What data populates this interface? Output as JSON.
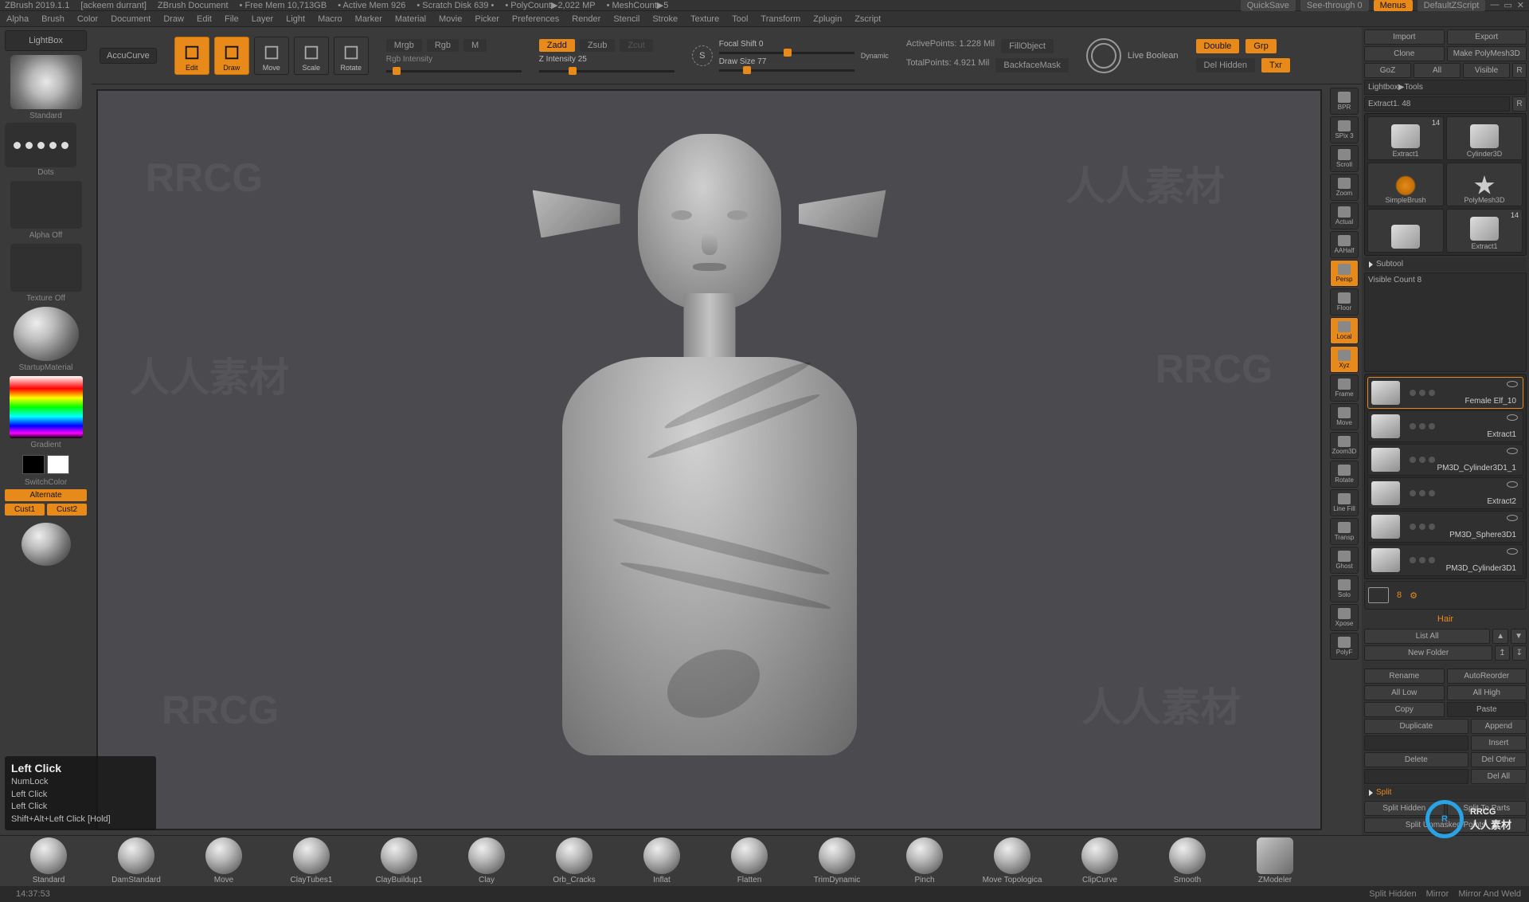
{
  "titlebar": {
    "app": "ZBrush 2019.1.1",
    "user": "[ackeem durrant]",
    "doc": "ZBrush Document",
    "free_mem": "Free Mem 10,713GB",
    "active_mem": "Active Mem 926",
    "scratch": "Scratch Disk 639",
    "polycount": "PolyCount▶2,022 MP",
    "meshcount": "MeshCount▶5",
    "quicksave": "QuickSave",
    "seethrough": "See-through  0",
    "menus": "Menus",
    "zscript": "DefaultZScript"
  },
  "menubar": [
    "Alpha",
    "Brush",
    "Color",
    "Document",
    "Draw",
    "Edit",
    "File",
    "Layer",
    "Light",
    "Macro",
    "Marker",
    "Material",
    "Movie",
    "Picker",
    "Preferences",
    "Render",
    "Stencil",
    "Stroke",
    "Texture",
    "Tool",
    "Transform",
    "Zplugin",
    "Zscript"
  ],
  "lightbox": "LightBox",
  "accucurve": "AccuCurve",
  "left": {
    "brush": "Standard",
    "stroke": "Dots",
    "alpha": "Alpha Off",
    "texture": "Texture Off",
    "material": "StartupMaterial",
    "gradient": "Gradient",
    "switch": "SwitchColor",
    "alternate": "Alternate",
    "cust1": "Cust1",
    "cust2": "Cust2"
  },
  "hint": {
    "title": "Left Click",
    "l1": "NumLock",
    "l2": "Left Click",
    "l3": "Left Click",
    "l4": "Shift+Alt+Left Click [Hold]"
  },
  "topshelf": {
    "gizmo": [
      "Edit",
      "Draw",
      "Move",
      "Scale",
      "Rotate"
    ],
    "mrgb": "Mrgb",
    "rgb": "Rgb",
    "m": "M",
    "zadd": "Zadd",
    "zsub": "Zsub",
    "zcut": "Zcut",
    "rgb_int": "Rgb Intensity",
    "z_int": "Z Intensity 25",
    "focal": "Focal Shift 0",
    "drawsize": "Draw Size 77",
    "dynamic": "Dynamic",
    "active": "ActivePoints: 1.228 Mil",
    "total": "TotalPoints: 4.921 Mil",
    "fill": "FillObject",
    "backface": "BackfaceMask",
    "liveboolean": "Live Boolean",
    "double": "Double",
    "grp": "Grp",
    "delhidden": "Del Hidden",
    "txr": "Txr"
  },
  "rightstrip": [
    "BPR",
    "SPix 3",
    "Scroll",
    "Zoom",
    "Actual",
    "AAHalf",
    "Persp",
    "Floor",
    "Local",
    "Xyz",
    "Frame",
    "Move",
    "Zoom3D",
    "Rotate",
    "Line Fill",
    "Transp",
    "Ghost",
    "Solo",
    "Xpose",
    "PolyF"
  ],
  "rightpanel": {
    "import": "Import",
    "export": "Export",
    "clone": "Clone",
    "makepoly": "Make PolyMesh3D",
    "goz": "GoZ",
    "all": "All",
    "visible": "Visible",
    "r": "R",
    "lightbox_tools": "Lightbox▶Tools",
    "extract": "Extract1.  48",
    "thumbs": [
      {
        "name": "Extract1",
        "count": "14"
      },
      {
        "name": "Cylinder3D",
        "count": ""
      },
      {
        "name": "SimpleBrush",
        "count": "",
        "kind": "spiral"
      },
      {
        "name": "PolyMesh3D",
        "count": "",
        "kind": "star"
      },
      {
        "name": "",
        "count": ""
      },
      {
        "name": "Extract1",
        "count": "14"
      }
    ],
    "subtool": "Subtool",
    "visible_count": "Visible Count 8",
    "items": [
      {
        "name": "Female Elf_10"
      },
      {
        "name": "Extract1"
      },
      {
        "name": "PM3D_Cylinder3D1_1"
      },
      {
        "name": "Extract2"
      },
      {
        "name": "PM3D_Sphere3D1"
      },
      {
        "name": "PM3D_Cylinder3D1"
      }
    ],
    "folder_count": "8",
    "folder_name": "Hair",
    "listall": "List All",
    "newfolder": "New Folder",
    "rename": "Rename",
    "autoreorder": "AutoReorder",
    "alllow": "All Low",
    "allhigh": "All High",
    "copy": "Copy",
    "paste": "Paste",
    "duplicate": "Duplicate",
    "append": "Append",
    "insert": "Insert",
    "delete": "Delete",
    "delother": "Del Other",
    "delall": "Del All",
    "split": "Split",
    "splithidden": "Split Hidden",
    "splitpart": "Split To Parts",
    "splitunmasked": "Split Unmasked Points"
  },
  "bottom": [
    "Standard",
    "DamStandard",
    "Move",
    "ClayTubes1",
    "ClayBuildup1",
    "Clay",
    "Orb_Cracks",
    "Inflat",
    "Flatten",
    "TrimDynamic",
    "Pinch",
    "Move Topologica",
    "ClipCurve",
    "Smooth",
    "ZModeler"
  ],
  "status": {
    "time": "14:37:53",
    "mirror": "Mirror",
    "mirrorweld": "Mirror And Weld",
    "splithidden": "Split Hidden"
  },
  "brand": {
    "name": "RRCG",
    "sub": "人人素材"
  }
}
